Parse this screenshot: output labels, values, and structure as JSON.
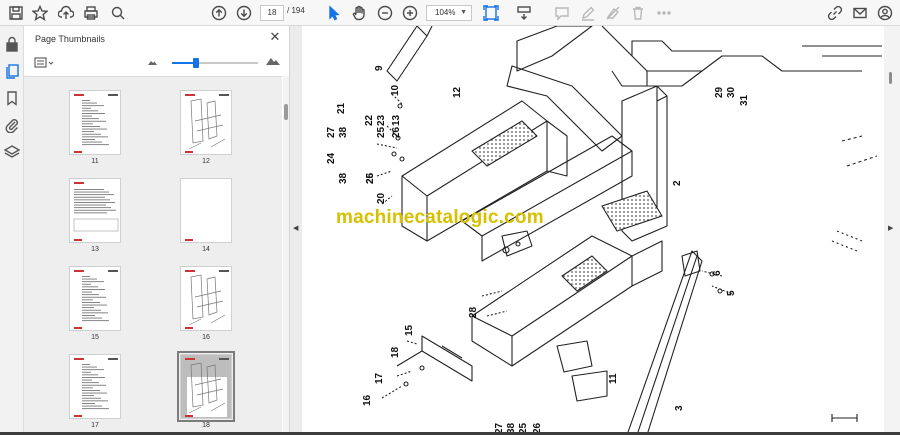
{
  "toolbar": {
    "page_current": "18",
    "page_total": "/ 194",
    "zoom_value": "104%",
    "icons": [
      "save-icon",
      "star-icon",
      "upload-icon",
      "print-icon",
      "search-icon",
      "page-up-icon",
      "page-down-icon",
      "select-arrow-icon",
      "hand-icon",
      "zoom-out-icon",
      "zoom-in-icon",
      "fit-page-icon",
      "scroll-mode-icon",
      "comment-icon",
      "pen-icon",
      "erase-icon",
      "delete-icon",
      "more-icon",
      "link-icon",
      "mail-icon",
      "user-icon"
    ]
  },
  "sidebar_rail": {
    "icons": [
      "lock-icon",
      "page-thumbnails-icon",
      "bookmark-icon",
      "attachment-icon",
      "layers-icon"
    ]
  },
  "panel": {
    "title": "Page Thumbnails",
    "close": "✕",
    "zoom_slider_value": 0.28
  },
  "thumbnails": [
    {
      "label": "11",
      "kind": "parts-list"
    },
    {
      "label": "12",
      "kind": "drawing"
    },
    {
      "label": "13",
      "kind": "text-table"
    },
    {
      "label": "14",
      "kind": "blank"
    },
    {
      "label": "15",
      "kind": "parts-list"
    },
    {
      "label": "16",
      "kind": "drawing"
    },
    {
      "label": "17",
      "kind": "parts-list"
    },
    {
      "label": "18",
      "kind": "drawing-dark",
      "selected": true
    }
  ],
  "document": {
    "watermark": "machinecatalogic.com",
    "callouts": [
      "9",
      "10",
      "12",
      "21",
      "22",
      "23",
      "13",
      "27",
      "38",
      "25",
      "26",
      "24",
      "38",
      "25",
      "26",
      "20",
      "2",
      "6",
      "5",
      "28",
      "15",
      "18",
      "17",
      "16",
      "11",
      "3",
      "27",
      "38",
      "25",
      "26",
      "29",
      "30",
      "31"
    ]
  },
  "colors": {
    "accent": "#1473e6",
    "watermark": "#d6c000"
  }
}
